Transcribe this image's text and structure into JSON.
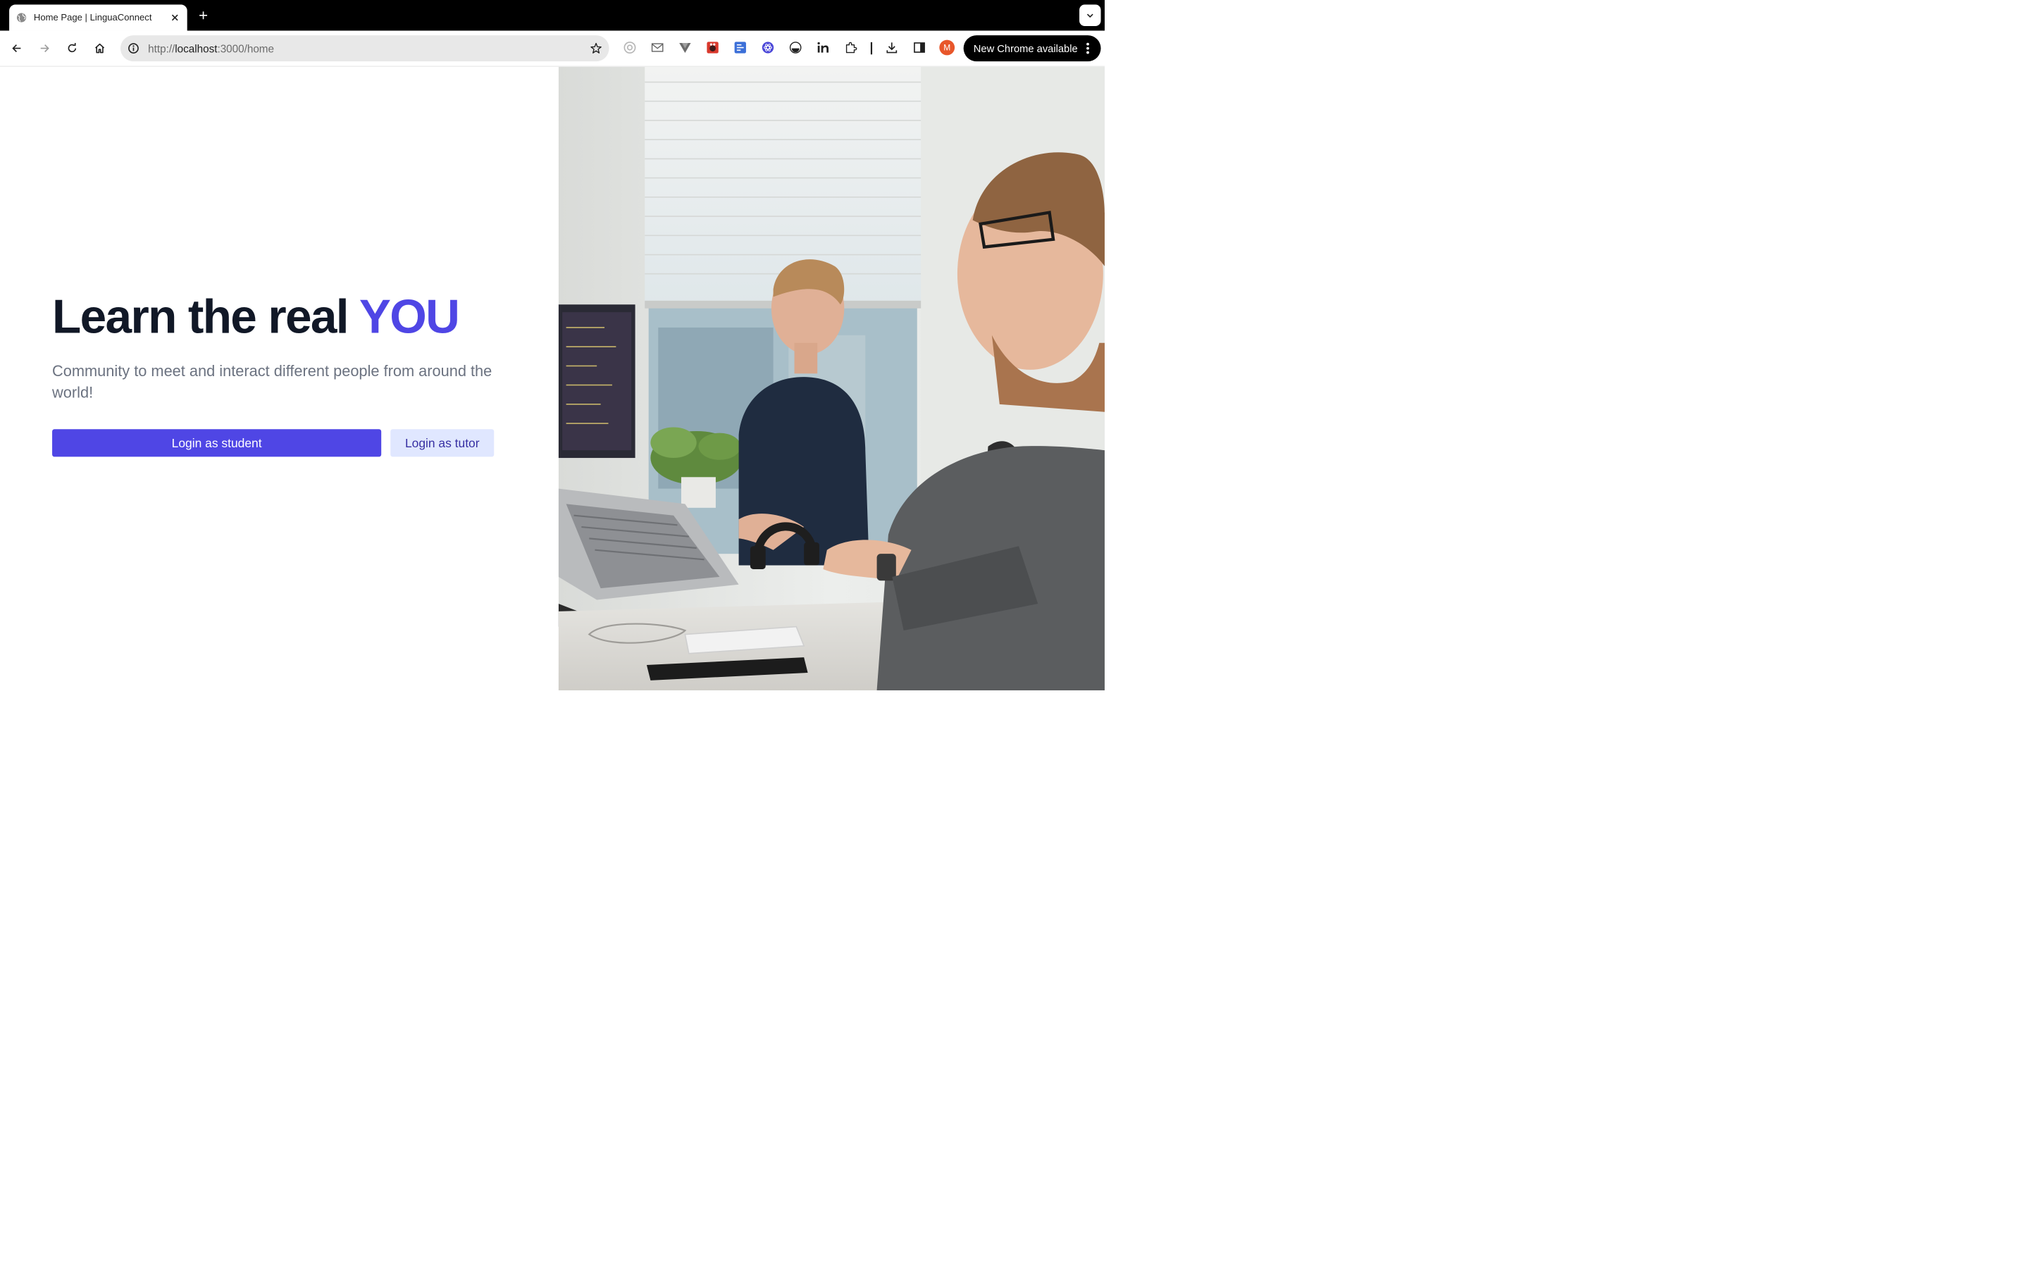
{
  "browser": {
    "tab": {
      "title": "Home Page | LinguaConnect",
      "favicon": "globe-icon"
    },
    "url": {
      "scheme": "http://",
      "host": "localhost",
      "path": ":3000/home"
    },
    "avatar_initial": "M",
    "update_label": "New Chrome available",
    "extensions": [
      "timer-extension-icon",
      "mail-extension-icon",
      "vue-devtools-icon",
      "bug-extension-icon",
      "grid-extension-icon",
      "react-devtools-icon",
      "tracker-extension-icon",
      "linkedin-extension-icon",
      "extensions-puzzle-icon"
    ]
  },
  "hero": {
    "title_main": "Learn the real ",
    "title_accent": "YOU",
    "subtitle": "Community to meet and interact different people from around the world!",
    "student_button": "Login as student",
    "tutor_button": "Login as tutor"
  },
  "colors": {
    "accent": "#4f46e5",
    "secondary_button_bg": "#e0e7ff",
    "secondary_button_text": "#3730a3",
    "heading": "#111827",
    "subtitle": "#6b7280",
    "avatar": "#e8562a"
  },
  "photo": {
    "icon": "office-photo"
  }
}
